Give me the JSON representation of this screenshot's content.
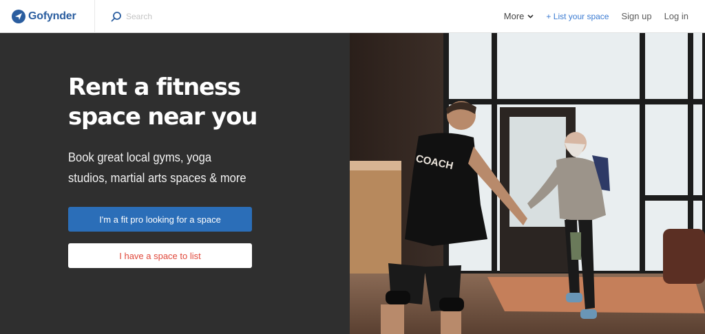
{
  "header": {
    "logo_text": "Gofynder",
    "search_placeholder": "Search",
    "nav": {
      "more": "More",
      "list_space": "+ List your space",
      "signup": "Sign up",
      "login": "Log in"
    }
  },
  "hero": {
    "title_line1": "Rent a fitness",
    "title_line2": "space near you",
    "subtitle_line1": "Book great local gyms, yoga",
    "subtitle_line2": "studios, martial arts spaces & more",
    "primary_button": "I'm a fit pro looking for a space",
    "secondary_button": "I have a space to list",
    "photo_shirt_text": "COACH"
  },
  "colors": {
    "brand": "#2a5d9f",
    "primary_button": "#2b6eb8",
    "secondary_text": "#e0473a",
    "hero_bg": "#2f2f2f"
  }
}
